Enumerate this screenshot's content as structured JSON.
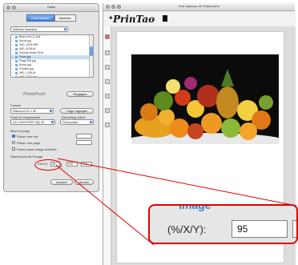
{
  "palette": {
    "title": "Outils",
    "tabs": [
      {
        "label": "Commandes"
      },
      {
        "label": "Modèles"
      }
    ],
    "source_label": "Affichez dossiers",
    "files": [
      {
        "name": "Bilan Avril 11.pdf"
      },
      {
        "name": "Bords.jpg"
      },
      {
        "name": "IMG_0003.NEF"
      },
      {
        "name": "IMG_0024.tif"
      },
      {
        "name": "Portrait studio 02.tif"
      },
      {
        "name": "Fruits.jpg"
      },
      {
        "name": "Plage Été.jpg"
      },
      {
        "name": "Boute.jpg"
      },
      {
        "name": "Feuilles.jpg"
      },
      {
        "name": "IMG_0106.tif"
      },
      {
        "name": "IMG_0201.jpg"
      }
    ],
    "selected_file_index": 5,
    "logo": "PhotoProof",
    "reglages_button": "Réglages",
    "format_label": "Format",
    "format_value": "Raccord 20 x 30",
    "page_button": "Page réglages",
    "profil_label": "Profil de l'imprimante",
    "profil_value": "SC-1400 PhFF HQ 2K",
    "rendu_label": "Rendering Intent",
    "rendu_value": "Perceptuel",
    "mise_label": "Mise en page",
    "option1": "Placer une fois",
    "option2": "Placer une page",
    "option3": "Placer aussi image suivante",
    "dimension_label": "Dimensions de l'image",
    "zoom_label": "(%/X/Y):",
    "zoom_value": "95",
    "x_value": "100",
    "y_value": "100",
    "annuler_button": "Annuler",
    "imprimer_button": "Imprimer",
    "ajouter_button": "Ajouter"
  },
  "document": {
    "title": "Vue d'aperçu de l'impression",
    "brand": "PrinTao"
  },
  "callout": {
    "big_text": "Image",
    "label": "(%/X/Y):",
    "value": "95"
  },
  "colors": {
    "accent": "#3f7fd6",
    "highlight": "#e00000"
  }
}
